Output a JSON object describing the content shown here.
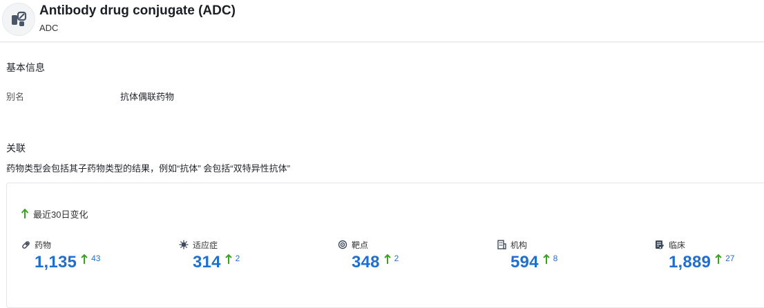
{
  "header": {
    "title": "Antibody drug conjugate (ADC)",
    "subtitle": "ADC",
    "logo_icon": "capsule-pill-icon"
  },
  "basic_info": {
    "section_title": "基本信息",
    "alias_label": "别名",
    "alias_value": "抗体偶联药物"
  },
  "relations": {
    "section_title": "关联",
    "note": "药物类型会包括其子药物类型的结果，例如“抗体” 会包括“双特异性抗体”"
  },
  "stats_card": {
    "change_label": "最近30日变化",
    "items": [
      {
        "icon": "pill-icon",
        "label": "药物",
        "value": "1,135",
        "delta": "43"
      },
      {
        "icon": "virus-icon",
        "label": "适应症",
        "value": "314",
        "delta": "2"
      },
      {
        "icon": "target-icon",
        "label": "靶点",
        "value": "348",
        "delta": "2"
      },
      {
        "icon": "building-icon",
        "label": "机构",
        "value": "594",
        "delta": "8"
      },
      {
        "icon": "clinical-doc-icon",
        "label": "临床",
        "value": "1,889",
        "delta": "27"
      }
    ]
  },
  "colors": {
    "accent": "#1e6fd1",
    "up": "#3aa31e",
    "icon": "#3d4a5c"
  }
}
